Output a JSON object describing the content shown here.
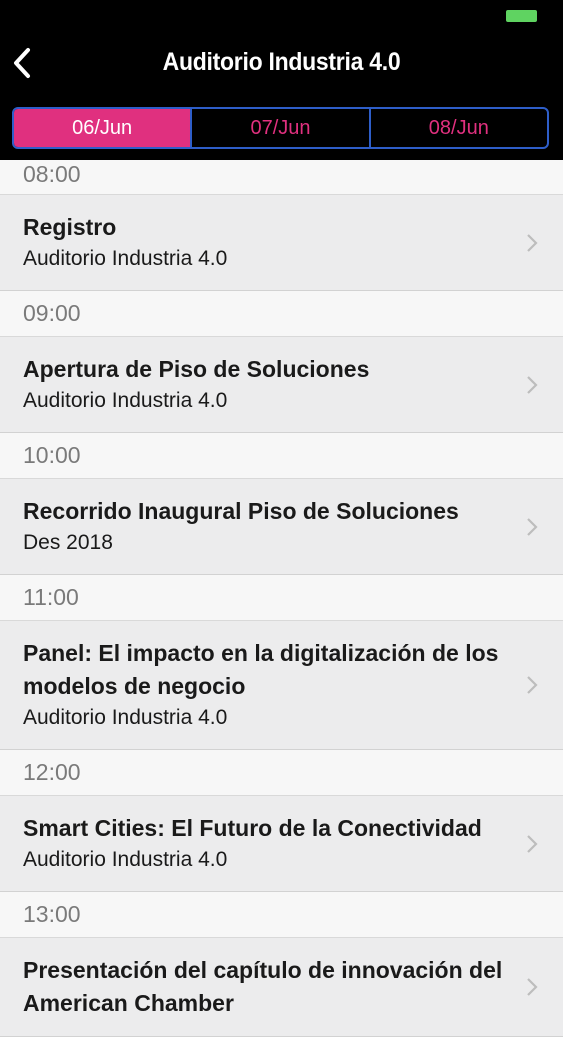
{
  "header": {
    "title": "Auditorio Industria 4.0",
    "tabs": [
      {
        "label": "06/Jun",
        "active": true
      },
      {
        "label": "07/Jun",
        "active": false
      },
      {
        "label": "08/Jun",
        "active": false
      }
    ]
  },
  "colors": {
    "accent": "#e0307f",
    "tab_border": "#2e5ec9",
    "battery": "#5fd361"
  },
  "schedule": [
    {
      "time": "08:00",
      "title": "Registro",
      "subtitle": "Auditorio Industria 4.0"
    },
    {
      "time": "09:00",
      "title": "Apertura de Piso de Soluciones",
      "subtitle": "Auditorio Industria 4.0"
    },
    {
      "time": "10:00",
      "title": "Recorrido Inaugural Piso de Soluciones",
      "subtitle": "Des 2018"
    },
    {
      "time": "11:00",
      "title": "Panel: El impacto en la digitalización de los modelos de negocio",
      "subtitle": "Auditorio Industria 4.0"
    },
    {
      "time": "12:00",
      "title": "Smart Cities: El Futuro de la Conectividad",
      "subtitle": "Auditorio Industria 4.0"
    },
    {
      "time": "13:00",
      "title": "Presentación del capítulo de innovación del American Chamber",
      "subtitle": ""
    }
  ]
}
